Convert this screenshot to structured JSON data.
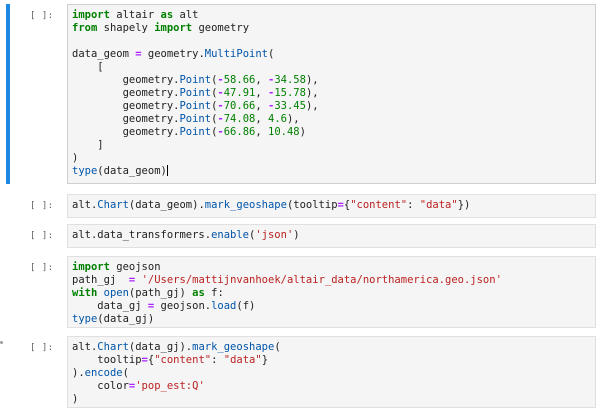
{
  "cells": [
    {
      "prompt": "[ ]:",
      "lines": [
        "import altair as alt",
        "from shapely import geometry",
        "",
        "data_geom = geometry.MultiPoint(",
        "    [",
        "        geometry.Point(-58.66, -34.58),",
        "        geometry.Point(-47.91, -15.78),",
        "        geometry.Point(-70.66, -33.45),",
        "        geometry.Point(-74.08, 4.6),",
        "        geometry.Point(-66.86, 10.48)",
        "    ]",
        ")",
        "type(data_geom)"
      ]
    },
    {
      "prompt": "[ ]:",
      "lines": [
        "alt.Chart(data_geom).mark_geoshape(tooltip={\"content\": \"data\"})"
      ]
    },
    {
      "prompt": "[ ]:",
      "lines": [
        "alt.data_transformers.enable('json')"
      ]
    },
    {
      "prompt": "[ ]:",
      "lines": [
        "import geojson",
        "path_gj  = '/Users/mattijnvanhoek/altair_data/northamerica.geo.json'",
        "with open(path_gj) as f:",
        "    data_gj = geojson.load(f)",
        "type(data_gj)"
      ]
    },
    {
      "prompt": "[ ]:",
      "lines": [
        "alt.Chart(data_gj).mark_geoshape(",
        "    tooltip={\"content\": \"data\"}",
        ").encode(",
        "    color='pop_est:Q'",
        ")"
      ]
    }
  ]
}
